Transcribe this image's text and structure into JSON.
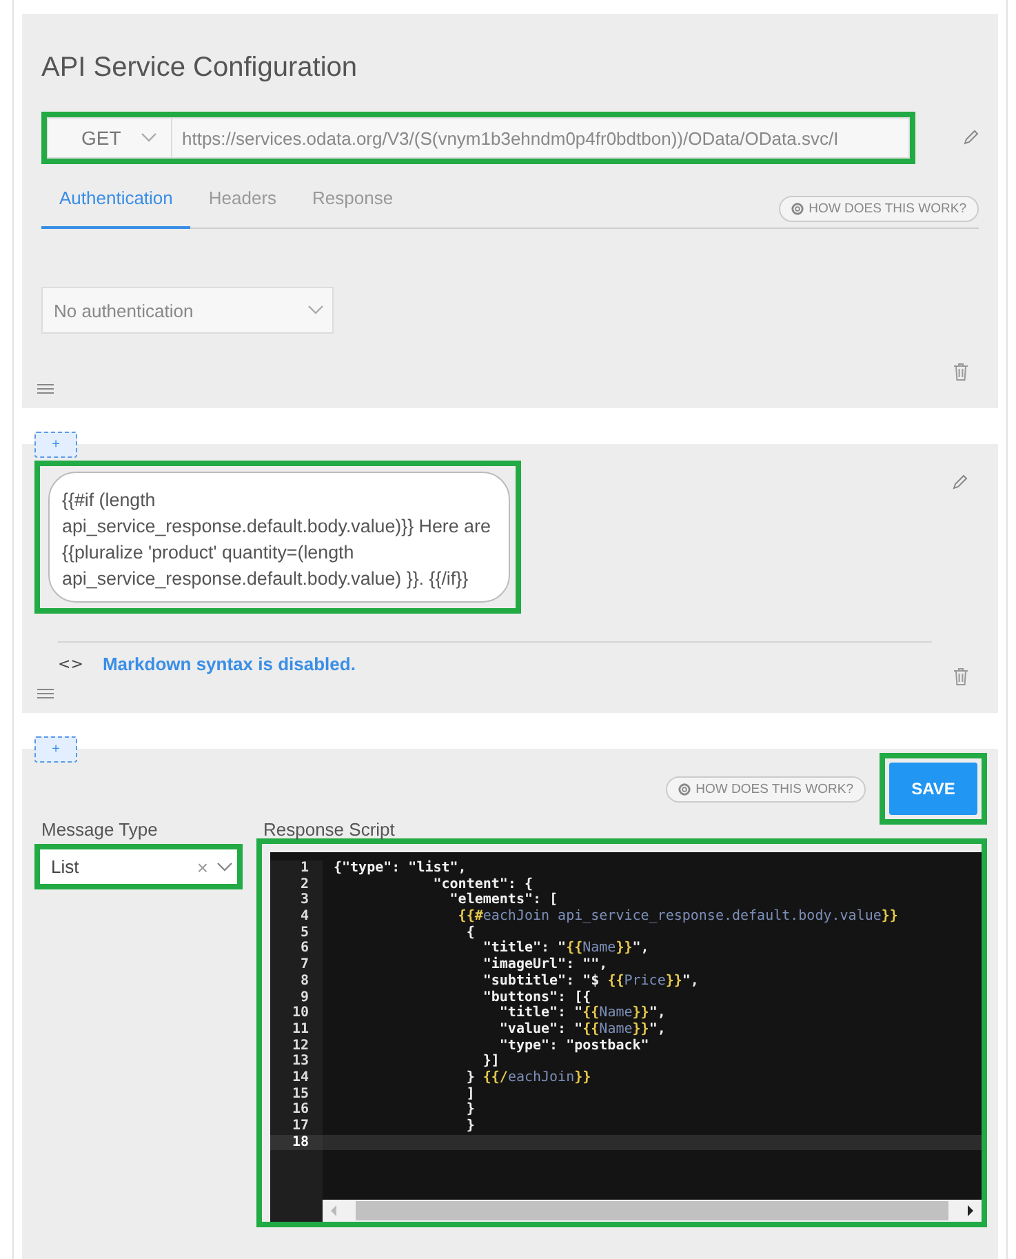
{
  "api_config": {
    "title": "API Service Configuration",
    "method": "GET",
    "url": "https://services.odata.org/V3/(S(vnym1b3ehndm0p4fr0bdtbon))/OData/OData.svc/I",
    "tabs": [
      {
        "label": "Authentication",
        "selected": true
      },
      {
        "label": "Headers",
        "selected": false
      },
      {
        "label": "Response",
        "selected": false
      }
    ],
    "help": "HOW DOES THIS WORK?",
    "auth": "No authentication"
  },
  "add_buttons": [
    "+",
    "+"
  ],
  "text_block": {
    "text": "{{#if (length api_service_response.default.body.value)}} Here are {{pluralize 'product' quantity=(length api_service_response.default.body.value) }}. {{/if}}",
    "markdown_glyph": "<>",
    "markdown_note": "Markdown syntax is disabled."
  },
  "script_block": {
    "help": "HOW DOES THIS WORK?",
    "save": "SAVE",
    "message_type_label": "Message Type",
    "message_type": "List",
    "clear": "×",
    "script_label": "Response Script",
    "lines": [
      {
        "number": "1",
        "active": false,
        "segments": [
          {
            "kind": "plain",
            "text": "{\"type\": \"list\","
          }
        ]
      },
      {
        "number": "2",
        "active": false,
        "segments": [
          {
            "kind": "plain",
            "text": "            \"content\": {"
          }
        ]
      },
      {
        "number": "3",
        "active": false,
        "segments": [
          {
            "kind": "plain",
            "text": "              \"elements\": ["
          }
        ]
      },
      {
        "number": "4",
        "active": false,
        "segments": [
          {
            "kind": "helper",
            "text": "               {{#"
          },
          {
            "kind": "var",
            "text": "eachJoin api_service_response.default.body.value"
          },
          {
            "kind": "helper",
            "text": "}}"
          }
        ]
      },
      {
        "number": "5",
        "active": false,
        "segments": [
          {
            "kind": "plain",
            "text": "                {"
          }
        ]
      },
      {
        "number": "6",
        "active": false,
        "segments": [
          {
            "kind": "plain",
            "text": "                  \"title\": \""
          },
          {
            "kind": "helper",
            "text": "{{"
          },
          {
            "kind": "var",
            "text": "Name"
          },
          {
            "kind": "helper",
            "text": "}}"
          },
          {
            "kind": "plain",
            "text": "\","
          }
        ]
      },
      {
        "number": "7",
        "active": false,
        "segments": [
          {
            "kind": "plain",
            "text": "                  \"imageUrl\": \"\","
          }
        ]
      },
      {
        "number": "8",
        "active": false,
        "segments": [
          {
            "kind": "plain",
            "text": "                  \"subtitle\": \"$ "
          },
          {
            "kind": "helper",
            "text": "{{"
          },
          {
            "kind": "var",
            "text": "Price"
          },
          {
            "kind": "helper",
            "text": "}}"
          },
          {
            "kind": "plain",
            "text": "\","
          }
        ]
      },
      {
        "number": "9",
        "active": false,
        "segments": [
          {
            "kind": "plain",
            "text": "                  \"buttons\": [{"
          }
        ]
      },
      {
        "number": "10",
        "active": false,
        "segments": [
          {
            "kind": "plain",
            "text": "                    \"title\": \""
          },
          {
            "kind": "helper",
            "text": "{{"
          },
          {
            "kind": "var",
            "text": "Name"
          },
          {
            "kind": "helper",
            "text": "}}"
          },
          {
            "kind": "plain",
            "text": "\","
          }
        ]
      },
      {
        "number": "11",
        "active": false,
        "segments": [
          {
            "kind": "plain",
            "text": "                    \"value\": \""
          },
          {
            "kind": "helper",
            "text": "{{"
          },
          {
            "kind": "var",
            "text": "Name"
          },
          {
            "kind": "helper",
            "text": "}}"
          },
          {
            "kind": "plain",
            "text": "\","
          }
        ]
      },
      {
        "number": "12",
        "active": false,
        "segments": [
          {
            "kind": "plain",
            "text": "                    \"type\": \"postback\""
          }
        ]
      },
      {
        "number": "13",
        "active": false,
        "segments": [
          {
            "kind": "plain",
            "text": "                  }]"
          }
        ]
      },
      {
        "number": "14",
        "active": false,
        "segments": [
          {
            "kind": "plain",
            "text": "                } "
          },
          {
            "kind": "helper",
            "text": "{{/"
          },
          {
            "kind": "var",
            "text": "eachJoin"
          },
          {
            "kind": "helper",
            "text": "}}"
          }
        ]
      },
      {
        "number": "15",
        "active": false,
        "segments": [
          {
            "kind": "plain",
            "text": "                ]"
          }
        ]
      },
      {
        "number": "16",
        "active": false,
        "segments": [
          {
            "kind": "plain",
            "text": "                }"
          }
        ]
      },
      {
        "number": "17",
        "active": false,
        "segments": [
          {
            "kind": "plain",
            "text": "                }"
          }
        ]
      },
      {
        "number": "18",
        "active": true
      }
    ]
  }
}
